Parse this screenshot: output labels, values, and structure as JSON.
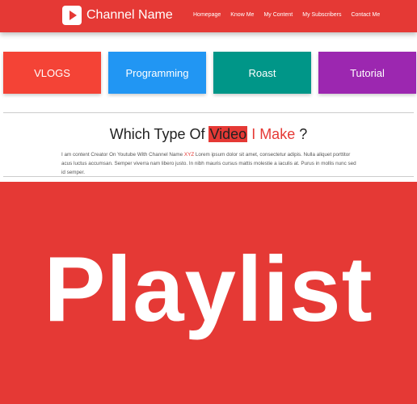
{
  "header": {
    "channel_name": "Channel Name",
    "logo_icon": "play-icon",
    "nav": [
      "Homepage",
      "Know Me",
      "My Content",
      "My Subscribers",
      "Contact Me"
    ]
  },
  "categories": [
    {
      "label": "VLOGS",
      "color": "#f44336"
    },
    {
      "label": "Programming",
      "color": "#2196f3"
    },
    {
      "label": "Roast",
      "color": "#009688"
    },
    {
      "label": "Tutorial",
      "color": "#9c27b0"
    }
  ],
  "section": {
    "heading_start": "Which Type Of ",
    "heading_highlight": "Video",
    "heading_accent": " I Make",
    "heading_end": " ?",
    "desc_start": "I am content Creator On Youtube With Channel Name ",
    "desc_accent": "XYZ",
    "desc_end": " Lorem ipsum dolor sit amet, consectetur adipis. Nulla aliquet porttitor acus luctus accumsan. Semper viverra nam libero justo. In nibh mauris cursus mattis molestie a iaculis at. Purus in mollis nunc sed id semper."
  },
  "banner": {
    "title": "Playlist"
  },
  "colors": {
    "primary": "#e53935",
    "text": "#222222"
  }
}
